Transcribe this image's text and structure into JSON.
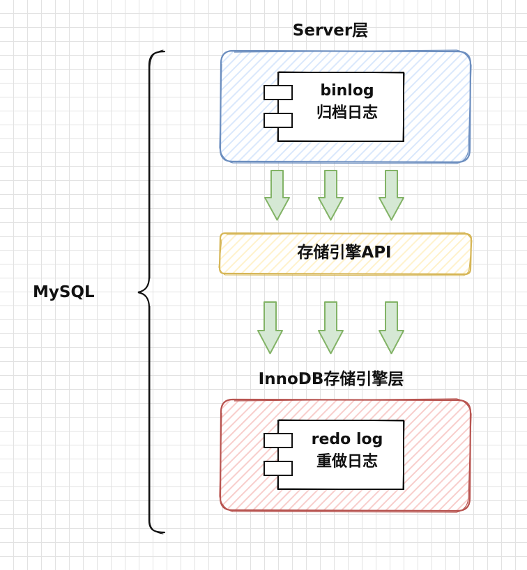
{
  "mysql_label": "MySQL",
  "server_layer": {
    "title": "Server层",
    "component": {
      "line1": "binlog",
      "line2": "归档日志"
    },
    "fill": "#dae8fc",
    "stroke": "#6c8ebf"
  },
  "api_layer": {
    "label": "存储引擎API",
    "fill": "#fff2cc",
    "stroke": "#d6b656"
  },
  "engine_layer": {
    "title": "InnoDB存储引擎层",
    "component": {
      "line1": "redo log",
      "line2": "重做日志"
    },
    "fill": "#f8cecc",
    "stroke": "#b85450"
  },
  "arrows": {
    "fill": "#d5e8d4",
    "stroke": "#82b366"
  }
}
